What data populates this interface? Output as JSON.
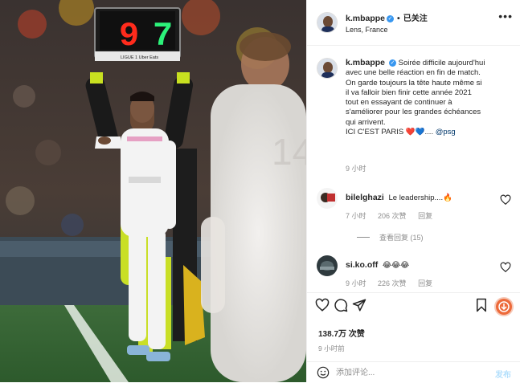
{
  "post": {
    "author": "k.mbappe",
    "follow_status": "已关注",
    "location": "Lens, France",
    "more_icon": "more-horizontal-icon"
  },
  "photo": {
    "board_left_digit": "9",
    "board_right_digit": "7",
    "board_brand": "LIGUE 1 Uber Eats",
    "shirt_number_right": "14",
    "colors": {
      "board_red": "#ff2b1c",
      "board_green": "#2cf27a",
      "kit_white": "#f3f3f3",
      "pink": "#e28bb6"
    }
  },
  "caption": {
    "username": "k.mbappe",
    "text_lines": [
      "Soirée difficile aujourd'hui",
      "avec une belle réaction en fin de match.",
      "On garde toujours la tête haute même si",
      "il va falloir bien finir cette année 2021",
      "tout en essayant de continuer à",
      "s'améliorer pour les grandes échéances",
      "qui arrivent."
    ],
    "closing": "ICI C'EST PARIS",
    "emoji_red_heart": "❤️",
    "emoji_blue_heart": "💙",
    "ellipsis": "....",
    "mention": "@psg",
    "time": "9 小时"
  },
  "comments": [
    {
      "username": "bilelghazi",
      "text": "Le leadership....",
      "emoji": "🔥",
      "time": "7 小时",
      "likes": "206 次赞",
      "reply": "回复"
    },
    {
      "username": "si.ko.off",
      "text": "",
      "emoji": "😂😂😂",
      "time": "9 小时",
      "likes": "226 次赞",
      "reply": "回复"
    }
  ],
  "view_replies": "查看回复 (15)",
  "actions": {
    "like_icon": "heart-outline-icon",
    "comment_icon": "comment-bubble-icon",
    "share_icon": "paper-plane-icon",
    "save_icon": "bookmark-icon",
    "download_icon": "download-badge-icon"
  },
  "likes_count": "138.7万 次赞",
  "posted_ago": "9 小时前",
  "composer": {
    "placeholder": "添加评论...",
    "post_label": "发布",
    "emoji_icon": "smiley-icon"
  },
  "verified_icon": "verified-badge-icon",
  "verified_glyph": "✓"
}
